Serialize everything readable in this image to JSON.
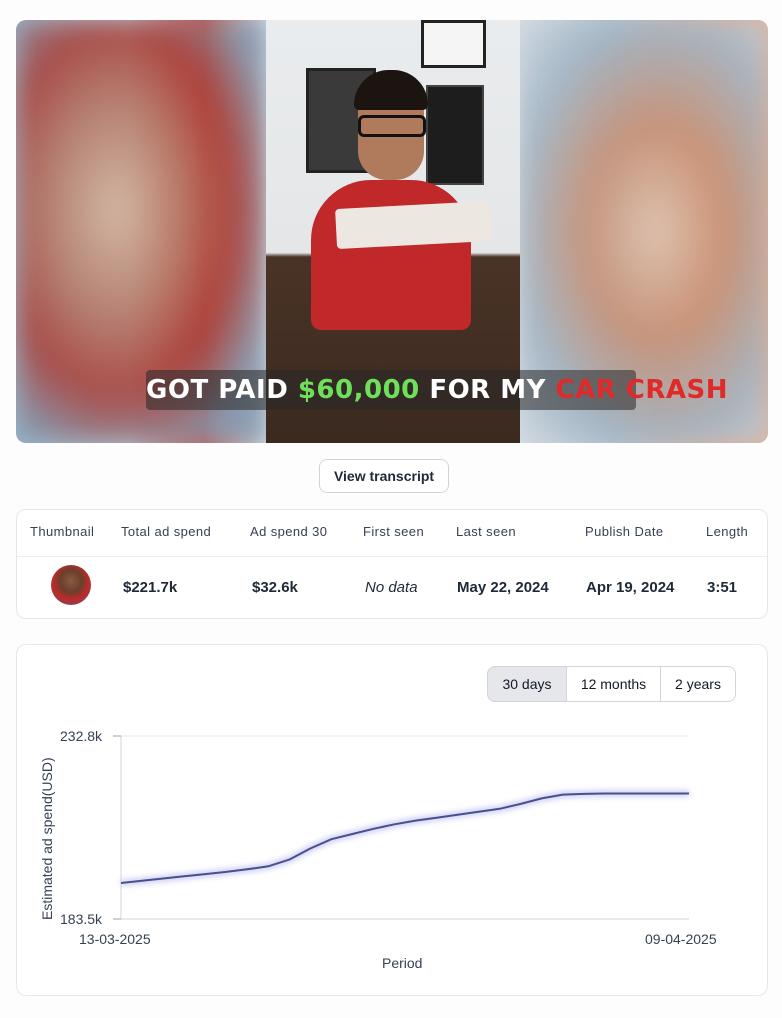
{
  "video": {
    "caption_part1": "GOT PAID ",
    "caption_amount": "$60,000",
    "caption_part2": " FOR MY ",
    "caption_highlight": "CAR CRASH"
  },
  "transcript_button": "View transcript",
  "table": {
    "headers": [
      "Thumbnail",
      "Total ad spend",
      "Ad spend 30",
      "First seen",
      "Last seen",
      "Publish Date",
      "Length"
    ],
    "row": {
      "total_ad_spend": "$221.7k",
      "ad_spend_30": "$32.6k",
      "first_seen": "No data",
      "last_seen": "May 22, 2024",
      "publish_date": "Apr 19, 2024",
      "length": "3:51"
    }
  },
  "range_buttons": [
    "30 days",
    "12 months",
    "2 years"
  ],
  "active_range": "30 days",
  "chart_data": {
    "type": "line",
    "xlabel": "Period",
    "ylabel": "Estimated ad spend(USD)",
    "ylim": [
      183.5,
      232.8
    ],
    "ytick_labels": [
      "232.8k",
      "183.5k"
    ],
    "xtick_labels": [
      "13-03-2025",
      "09-04-2025"
    ],
    "color": "#4b4f8c",
    "series": [
      {
        "x": [
          "13-03-2025",
          "14-03-2025",
          "15-03-2025",
          "16-03-2025",
          "17-03-2025",
          "18-03-2025",
          "19-03-2025",
          "20-03-2025",
          "21-03-2025",
          "22-03-2025",
          "23-03-2025",
          "24-03-2025",
          "25-03-2025",
          "26-03-2025",
          "27-03-2025",
          "28-03-2025",
          "29-03-2025",
          "30-03-2025",
          "31-03-2025",
          "01-04-2025",
          "02-04-2025",
          "03-04-2025",
          "04-04-2025",
          "05-04-2025",
          "06-04-2025",
          "07-04-2025",
          "08-04-2025",
          "09-04-2025"
        ],
        "values": [
          193.2,
          193.8,
          194.4,
          195.0,
          195.6,
          196.2,
          196.9,
          197.7,
          199.5,
          202.5,
          205.0,
          206.4,
          207.8,
          209.0,
          210.0,
          210.8,
          211.6,
          212.4,
          213.2,
          214.5,
          216.0,
          217.0,
          217.2,
          217.3,
          217.3,
          217.3,
          217.3,
          217.3
        ]
      }
    ]
  }
}
